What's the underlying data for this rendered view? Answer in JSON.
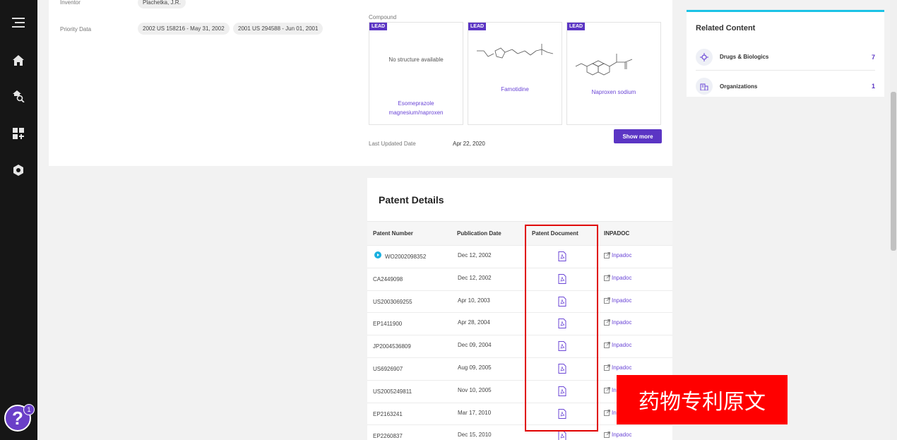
{
  "sidebar": {
    "icons": [
      "menu-icon",
      "home-icon",
      "search-icon",
      "dashboard-icon",
      "logo-icon"
    ],
    "help_label": "?",
    "help_badge": "1"
  },
  "summary": {
    "inventor_label": "Inventor",
    "inventor_value": "Plachetka, J.R.",
    "priority_label": "Priority Data",
    "priority_chips": [
      "2002 US 158216 - May 31, 2002",
      "2001 US 294588 - Jun 01, 2001"
    ],
    "compound_label": "Compound",
    "lead_tag": "LEAD",
    "compounds": [
      {
        "name": "Esomeprazole magnesium/naproxen",
        "structure": "No structure available"
      },
      {
        "name": "Famotidine",
        "structure": ""
      },
      {
        "name": "Naproxen sodium",
        "structure": ""
      }
    ],
    "show_more": "Show more",
    "last_updated_label": "Last Updated Date",
    "last_updated_value": "Apr 22, 2020"
  },
  "related": {
    "title": "Related Content",
    "items": [
      {
        "label": "Drugs & Biologics",
        "count": "7",
        "icon": "drug-icon"
      },
      {
        "label": "Organizations",
        "count": "1",
        "icon": "building-icon"
      }
    ]
  },
  "patents": {
    "title": "Patent Details",
    "columns": [
      "Patent Number",
      "Publication Date",
      "Patent Document",
      "INPADOC"
    ],
    "inpadoc_label": "Inpadoc",
    "rows": [
      {
        "number": "WO2002098352",
        "date": "Dec 12, 2002"
      },
      {
        "number": "CA2449098",
        "date": "Dec 12, 2002"
      },
      {
        "number": "US2003069255",
        "date": "Apr 10, 2003"
      },
      {
        "number": "EP1411900",
        "date": "Apr 28, 2004"
      },
      {
        "number": "JP2004536809",
        "date": "Dec 09, 2004"
      },
      {
        "number": "US6926907",
        "date": "Aug 09, 2005"
      },
      {
        "number": "US2005249811",
        "date": "Nov 10, 2005"
      },
      {
        "number": "EP2163241",
        "date": "Mar 17, 2010"
      },
      {
        "number": "EP2260837",
        "date": "Dec 15, 2010"
      }
    ]
  },
  "overlay_text": "药物专利原文",
  "colors": {
    "accent": "#5b35c4",
    "highlight": "#e00000",
    "related_top": "#1cc3e6"
  }
}
